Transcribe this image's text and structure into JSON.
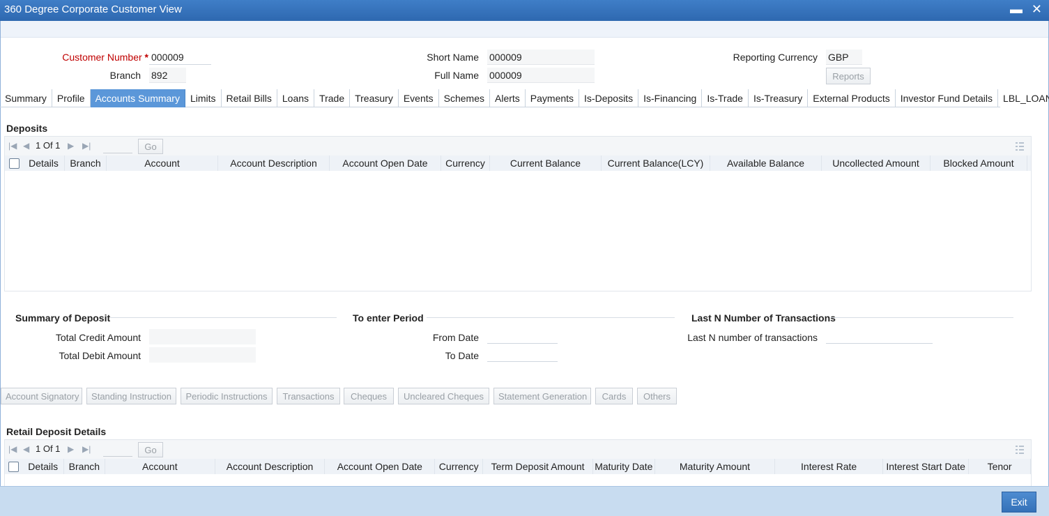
{
  "window": {
    "title": "360 Degree Corporate Customer View",
    "close_glyph": "✕",
    "minimize_glyph": "▬"
  },
  "header": {
    "customer_number_label": "Customer Number",
    "customer_number_required": "*",
    "customer_number_value": "000009",
    "branch_label": "Branch",
    "branch_value": "892",
    "short_name_label": "Short Name",
    "short_name_value": "000009",
    "full_name_label": "Full Name",
    "full_name_value": "000009",
    "reporting_currency_label": "Reporting Currency",
    "reporting_currency_value": "GBP",
    "reports_button": "Reports"
  },
  "tabs": [
    {
      "label": "Summary",
      "active": false
    },
    {
      "label": "Profile",
      "active": false
    },
    {
      "label": "Accounts Summary",
      "active": true
    },
    {
      "label": "Limits",
      "active": false
    },
    {
      "label": "Retail Bills",
      "active": false
    },
    {
      "label": "Loans",
      "active": false
    },
    {
      "label": "Trade",
      "active": false
    },
    {
      "label": "Treasury",
      "active": false
    },
    {
      "label": "Events",
      "active": false
    },
    {
      "label": "Schemes",
      "active": false
    },
    {
      "label": "Alerts",
      "active": false
    },
    {
      "label": "Payments",
      "active": false
    },
    {
      "label": "Is-Deposits",
      "active": false
    },
    {
      "label": "Is-Financing",
      "active": false
    },
    {
      "label": "Is-Trade",
      "active": false
    },
    {
      "label": "Is-Treasury",
      "active": false
    },
    {
      "label": "External Products",
      "active": false
    },
    {
      "label": "Investor Fund Details",
      "active": false
    },
    {
      "label": "LBL_LOAN_FLL",
      "active": false
    }
  ],
  "deposits": {
    "title": "Deposits",
    "pager_text": "1 Of 1",
    "go_button": "Go",
    "columns": [
      "Details",
      "Branch",
      "Account",
      "Account Description",
      "Account Open Date",
      "Currency",
      "Current Balance",
      "Current Balance(LCY)",
      "Available Balance",
      "Uncollected Amount",
      "Blocked Amount"
    ]
  },
  "summary_of_deposit": {
    "title": "Summary of Deposit",
    "total_credit_label": "Total Credit Amount",
    "total_credit_value": "",
    "total_debit_label": "Total Debit Amount",
    "total_debit_value": ""
  },
  "period": {
    "title": "To enter Period",
    "from_label": "From Date",
    "from_value": "",
    "to_label": "To Date",
    "to_value": ""
  },
  "last_n": {
    "title": "Last N Number of Transactions",
    "label": "Last N number of transactions",
    "value": ""
  },
  "actions": [
    "Account Signatory",
    "Standing Instruction",
    "Periodic Instructions",
    "Transactions",
    "Cheques",
    "Uncleared Cheques",
    "Statement Generation",
    "Cards",
    "Others"
  ],
  "retail_deposit": {
    "title": "Retail Deposit Details",
    "pager_text": "1 Of 1",
    "go_button": "Go",
    "columns": [
      "Details",
      "Branch",
      "Account",
      "Account Description",
      "Account Open Date",
      "Currency",
      "Term Deposit Amount",
      "Maturity Date",
      "Maturity Amount",
      "Interest Rate",
      "Interest Start Date",
      "Tenor"
    ]
  },
  "footer": {
    "exit_button": "Exit"
  },
  "colors": {
    "title_bar": "#2e68b0",
    "active_tab": "#5b97d9",
    "required": "#c00000",
    "footer": "#c8dcf0"
  }
}
